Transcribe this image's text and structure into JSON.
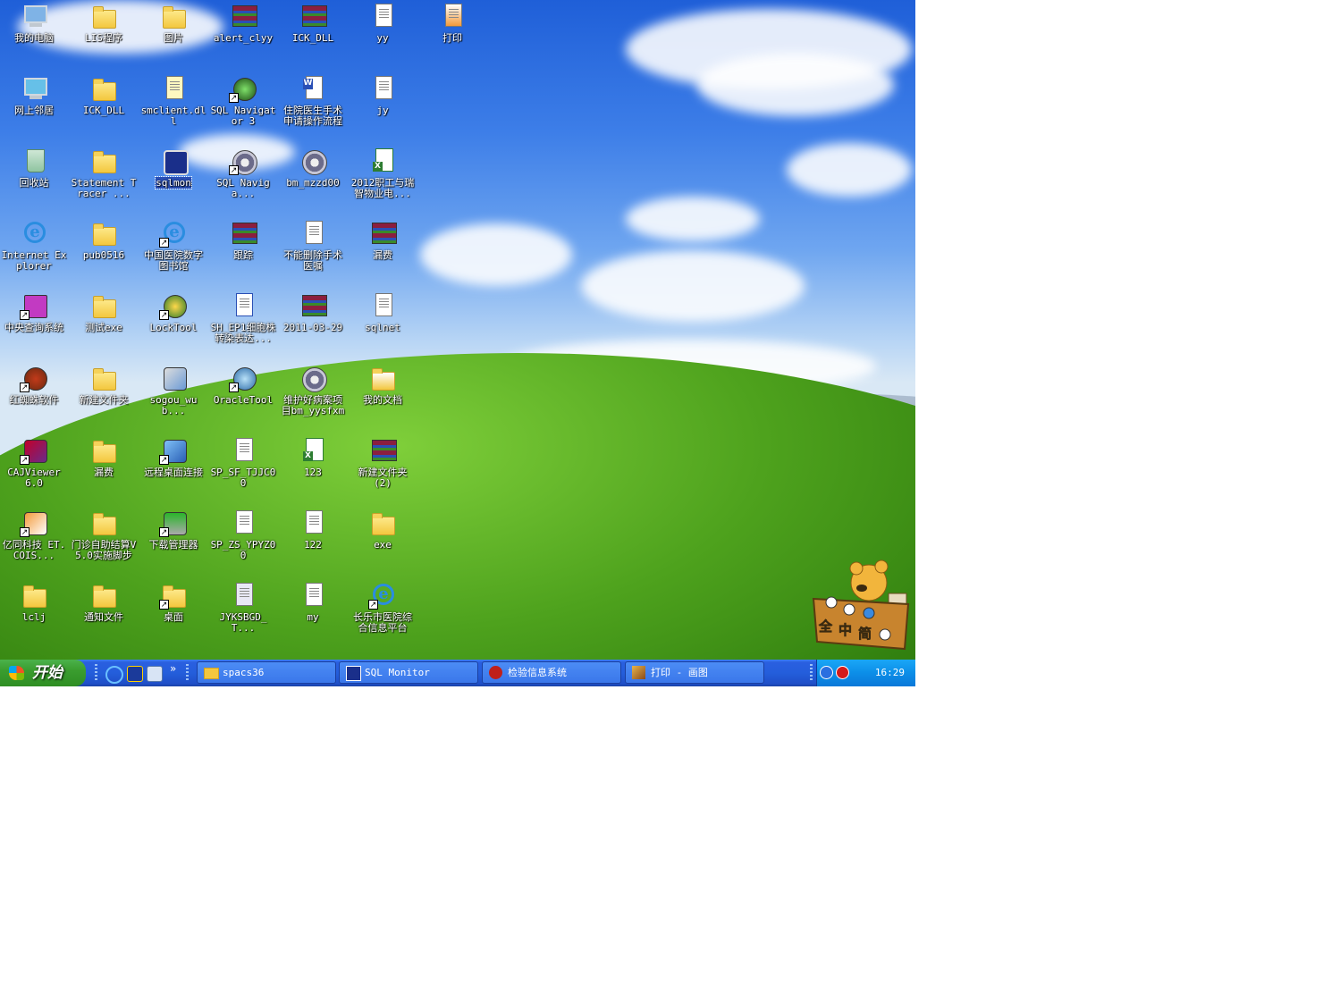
{
  "desktop": {
    "icons": [
      {
        "label": "我的电脑",
        "type": "pc",
        "shortcut": false
      },
      {
        "label": "LIS程序",
        "type": "folder",
        "shortcut": false
      },
      {
        "label": "图片",
        "type": "folder",
        "shortcut": false
      },
      {
        "label": "alert_clyy",
        "type": "rar",
        "shortcut": false
      },
      {
        "label": "ICK_DLL",
        "type": "rar",
        "shortcut": false
      },
      {
        "label": "yy",
        "type": "doc",
        "shortcut": false
      },
      {
        "label": "打印",
        "type": "paint",
        "shortcut": false
      },
      {
        "label": "网上邻居",
        "type": "network",
        "shortcut": false
      },
      {
        "label": "ICK_DLL",
        "type": "folder",
        "shortcut": false
      },
      {
        "label": "smclient.dll",
        "type": "dll",
        "shortcut": false
      },
      {
        "label": "SQL Navigator 3",
        "type": "sqlnav",
        "shortcut": true
      },
      {
        "label": "住院医生手术申请操作流程",
        "type": "word",
        "shortcut": false
      },
      {
        "label": "jy",
        "type": "doc",
        "shortcut": false
      },
      {
        "label": "回收站",
        "type": "bin",
        "shortcut": false
      },
      {
        "label": "Statement Tracer ...",
        "type": "folder",
        "shortcut": false
      },
      {
        "label": "sqlmon",
        "type": "sqlmon",
        "shortcut": false,
        "selected": true
      },
      {
        "label": "SQL Naviga...",
        "type": "gear",
        "shortcut": true
      },
      {
        "label": "bm_mzzd00",
        "type": "gear",
        "shortcut": false
      },
      {
        "label": "2012职工与瑞智物业电...",
        "type": "excel",
        "shortcut": false
      },
      {
        "label": "Internet Explorer",
        "type": "ie",
        "shortcut": false
      },
      {
        "label": "pub0516",
        "type": "folder",
        "shortcut": false
      },
      {
        "label": "中国医院数字图书馆",
        "type": "ie",
        "shortcut": true
      },
      {
        "label": "跟踪",
        "type": "rar",
        "shortcut": false
      },
      {
        "label": "不能删除手术医嘱",
        "type": "doc",
        "shortcut": false
      },
      {
        "label": "漏费",
        "type": "rar",
        "shortcut": false
      },
      {
        "label": "中央查询系统",
        "type": "tree",
        "shortcut": true
      },
      {
        "label": "测试exe",
        "type": "folder",
        "shortcut": false
      },
      {
        "label": "LockTool",
        "type": "lock",
        "shortcut": true
      },
      {
        "label": "SH_EP1细胞株转染表达...",
        "type": "cat",
        "shortcut": false
      },
      {
        "label": "2011-03-29",
        "type": "rar",
        "shortcut": false
      },
      {
        "label": "sqlnet",
        "type": "doc",
        "shortcut": false
      },
      {
        "label": "红蜘蛛软件",
        "type": "spider",
        "shortcut": true
      },
      {
        "label": "新建文件夹",
        "type": "folder",
        "shortcut": false
      },
      {
        "label": "sogou_wub...",
        "type": "installer",
        "shortcut": false
      },
      {
        "label": "OracleTool",
        "type": "oracle",
        "shortcut": true
      },
      {
        "label": "维护好病案项目bm_yysfxm",
        "type": "gear",
        "shortcut": false
      },
      {
        "label": "我的文档",
        "type": "mydocs",
        "shortcut": false
      },
      {
        "label": "CAJViewer 6.0",
        "type": "caj",
        "shortcut": true
      },
      {
        "label": "漏费",
        "type": "folder",
        "shortcut": false
      },
      {
        "label": "远程桌面连接",
        "type": "remote",
        "shortcut": true
      },
      {
        "label": "SP_SF_TJJC00",
        "type": "doc",
        "shortcut": false
      },
      {
        "label": "123",
        "type": "excel",
        "shortcut": false
      },
      {
        "label": "新建文件夹 (2)",
        "type": "rar",
        "shortcut": false
      },
      {
        "label": "亿同科技 ET.COIS...",
        "type": "yitong",
        "shortcut": true
      },
      {
        "label": "门诊自助结算V5.0实施脚步",
        "type": "folder",
        "shortcut": false
      },
      {
        "label": "下载管理器",
        "type": "download",
        "shortcut": true
      },
      {
        "label": "SP_ZS_YPYZ00",
        "type": "doc",
        "shortcut": false
      },
      {
        "label": "122",
        "type": "doc",
        "shortcut": false
      },
      {
        "label": "exe",
        "type": "folder",
        "shortcut": false
      },
      {
        "label": "lclj",
        "type": "folder",
        "shortcut": false
      },
      {
        "label": "通知文件",
        "type": "folder",
        "shortcut": false
      },
      {
        "label": "桌面",
        "type": "folder",
        "shortcut": true
      },
      {
        "label": "JYKSBGD_T...",
        "type": "image",
        "shortcut": false
      },
      {
        "label": "my",
        "type": "doc",
        "shortcut": false
      },
      {
        "label": "长乐市医院综合信息平台",
        "type": "ie",
        "shortcut": true
      }
    ],
    "widget": {
      "chars": [
        "全",
        "中",
        "简"
      ],
      "name": "pooh-input-method-widget"
    }
  },
  "taskbar": {
    "start_label": "开始",
    "quick_launch": [
      "ie-icon",
      "anchor-icon",
      "outlook-icon"
    ],
    "quick_launch_more": "»",
    "tasks": [
      {
        "label": "spacs36",
        "icon": "folder-icon"
      },
      {
        "label": "SQL Monitor",
        "icon": "sqlmon-icon"
      },
      {
        "label": "检验信息系统",
        "icon": "lab-system-icon"
      },
      {
        "label": "打印 - 画图",
        "icon": "paint-icon"
      }
    ],
    "tray": {
      "time": "16:29",
      "icons": [
        "sogou-icon",
        "arrow-left-icon",
        "stop-icon"
      ]
    }
  },
  "colors": {
    "taskbar": "#245edb",
    "start": "#3a9d2f",
    "tray": "#0c8ee8"
  }
}
